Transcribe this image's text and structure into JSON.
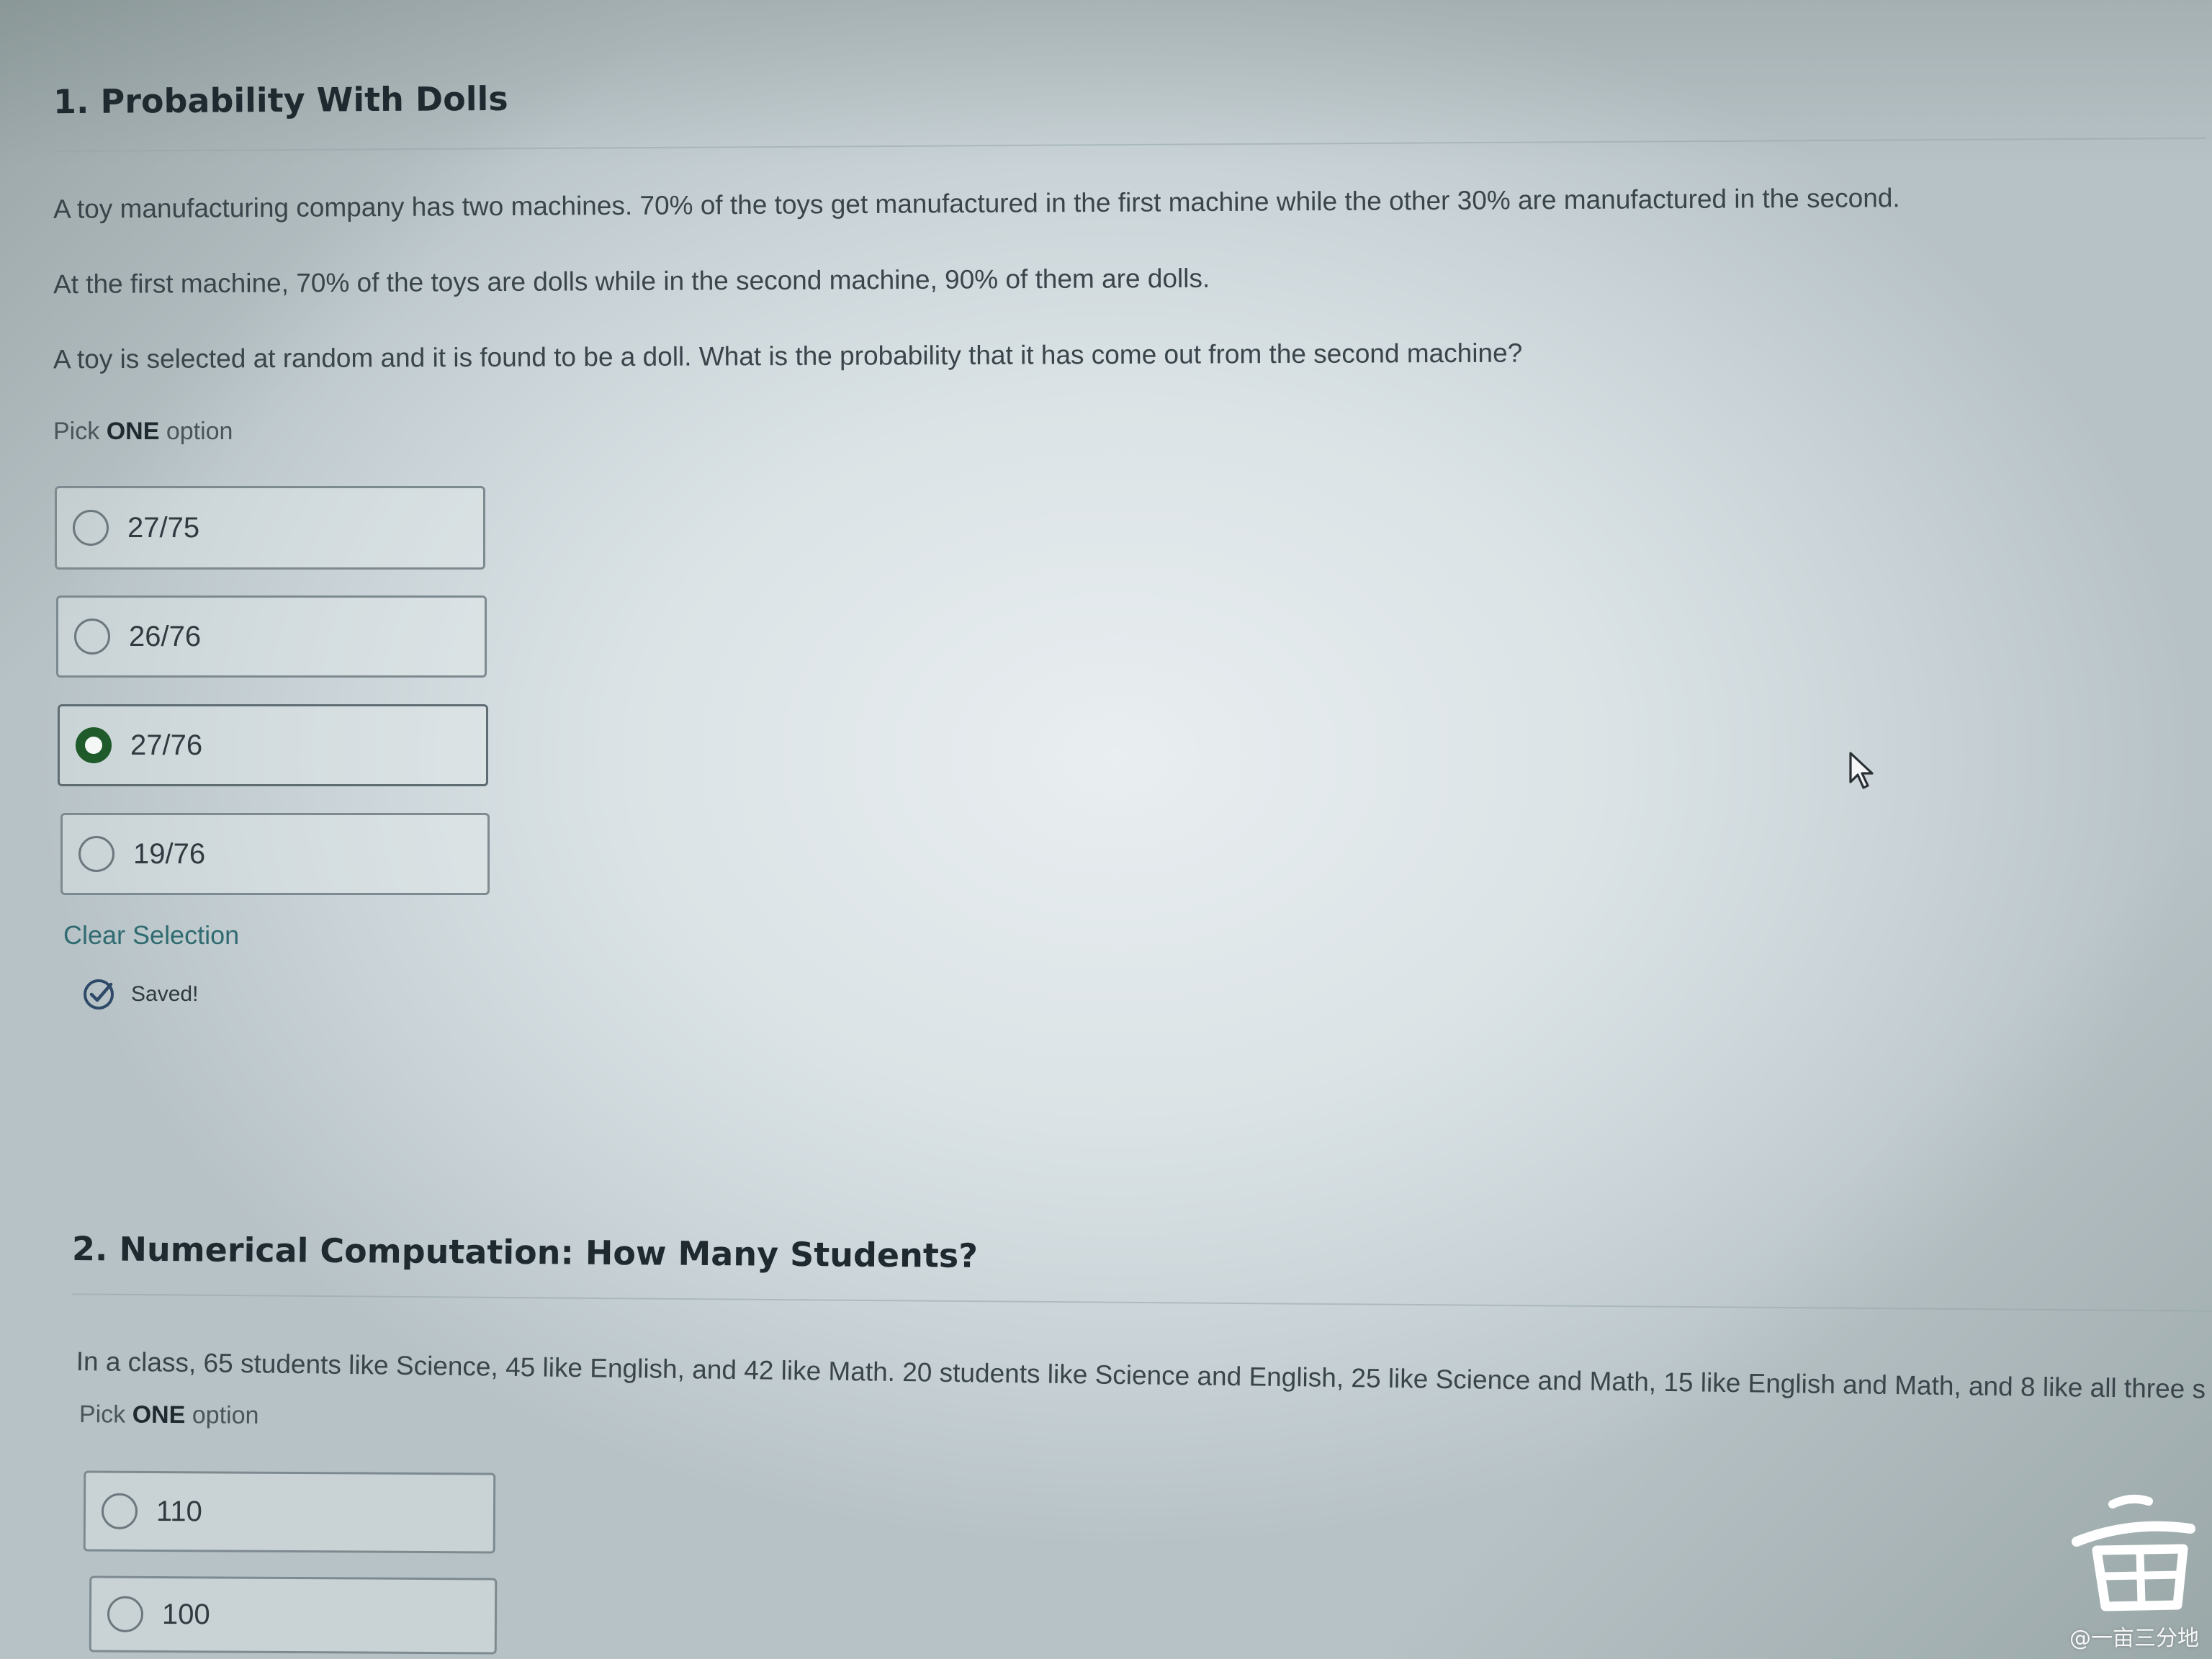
{
  "question1": {
    "title": "1. Probability With Dolls",
    "paragraphs": [
      "A toy manufacturing company has two machines. 70% of the toys get manufactured in the first machine while the other 30% are manufactured in the second.",
      "At the first machine, 70% of the toys are dolls while in the second machine, 90% of them are dolls.",
      "A toy is selected at random and it is found to be a doll. What is the probability that it has come out from the second machine?"
    ],
    "pick_prefix": "Pick ",
    "pick_bold": "ONE",
    "pick_suffix": " option",
    "options": [
      {
        "label": "27/75",
        "selected": false
      },
      {
        "label": "26/76",
        "selected": false
      },
      {
        "label": "27/76",
        "selected": true
      },
      {
        "label": "19/76",
        "selected": false
      }
    ],
    "clear_label": "Clear Selection",
    "saved_label": "Saved!"
  },
  "question2": {
    "title": "2. Numerical Computation: How Many Students?",
    "paragraph": "In a class, 65 students like Science, 45 like English, and 42 like Math. 20 students like Science and English, 25 like Science and Math, 15 like English and Math, and 8 like all three s",
    "pick_prefix": "Pick ",
    "pick_bold": "ONE",
    "pick_suffix": " option",
    "options": [
      {
        "label": "110",
        "selected": false
      },
      {
        "label": "100",
        "selected": false
      }
    ]
  },
  "watermark": {
    "text": "@一亩三分地"
  },
  "colors": {
    "selected_radio": "#1f5a2a",
    "link": "#2f6b70"
  }
}
